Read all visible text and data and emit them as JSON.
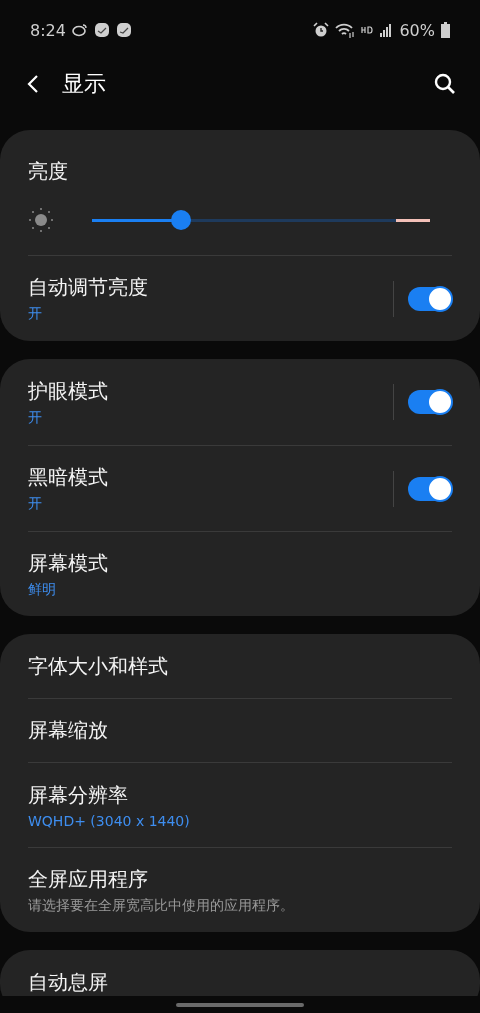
{
  "status_bar": {
    "time": "8:24",
    "battery": "60%"
  },
  "header": {
    "title": "显示"
  },
  "sections": [
    {
      "items": [
        {
          "kind": "slider",
          "title": "亮度",
          "level": 0.27
        },
        {
          "kind": "toggle",
          "title": "自动调节亮度",
          "subtitle": "开",
          "on": true
        }
      ]
    },
    {
      "items": [
        {
          "kind": "toggle",
          "title": "护眼模式",
          "subtitle": "开",
          "on": true
        },
        {
          "kind": "toggle",
          "title": "黑暗模式",
          "subtitle": "开",
          "on": true
        },
        {
          "kind": "value",
          "title": "屏幕模式",
          "subtitle": "鲜明"
        }
      ]
    },
    {
      "items": [
        {
          "kind": "plain",
          "title": "字体大小和样式"
        },
        {
          "kind": "plain",
          "title": "屏幕缩放"
        },
        {
          "kind": "value",
          "title": "屏幕分辨率",
          "subtitle": "WQHD+ (3040 x 1440)"
        },
        {
          "kind": "description",
          "title": "全屏应用程序",
          "subtitle": "请选择要在全屏宽高比中使用的应用程序。"
        }
      ]
    },
    {
      "items": [
        {
          "kind": "plain",
          "title": "自动息屏"
        }
      ]
    }
  ]
}
